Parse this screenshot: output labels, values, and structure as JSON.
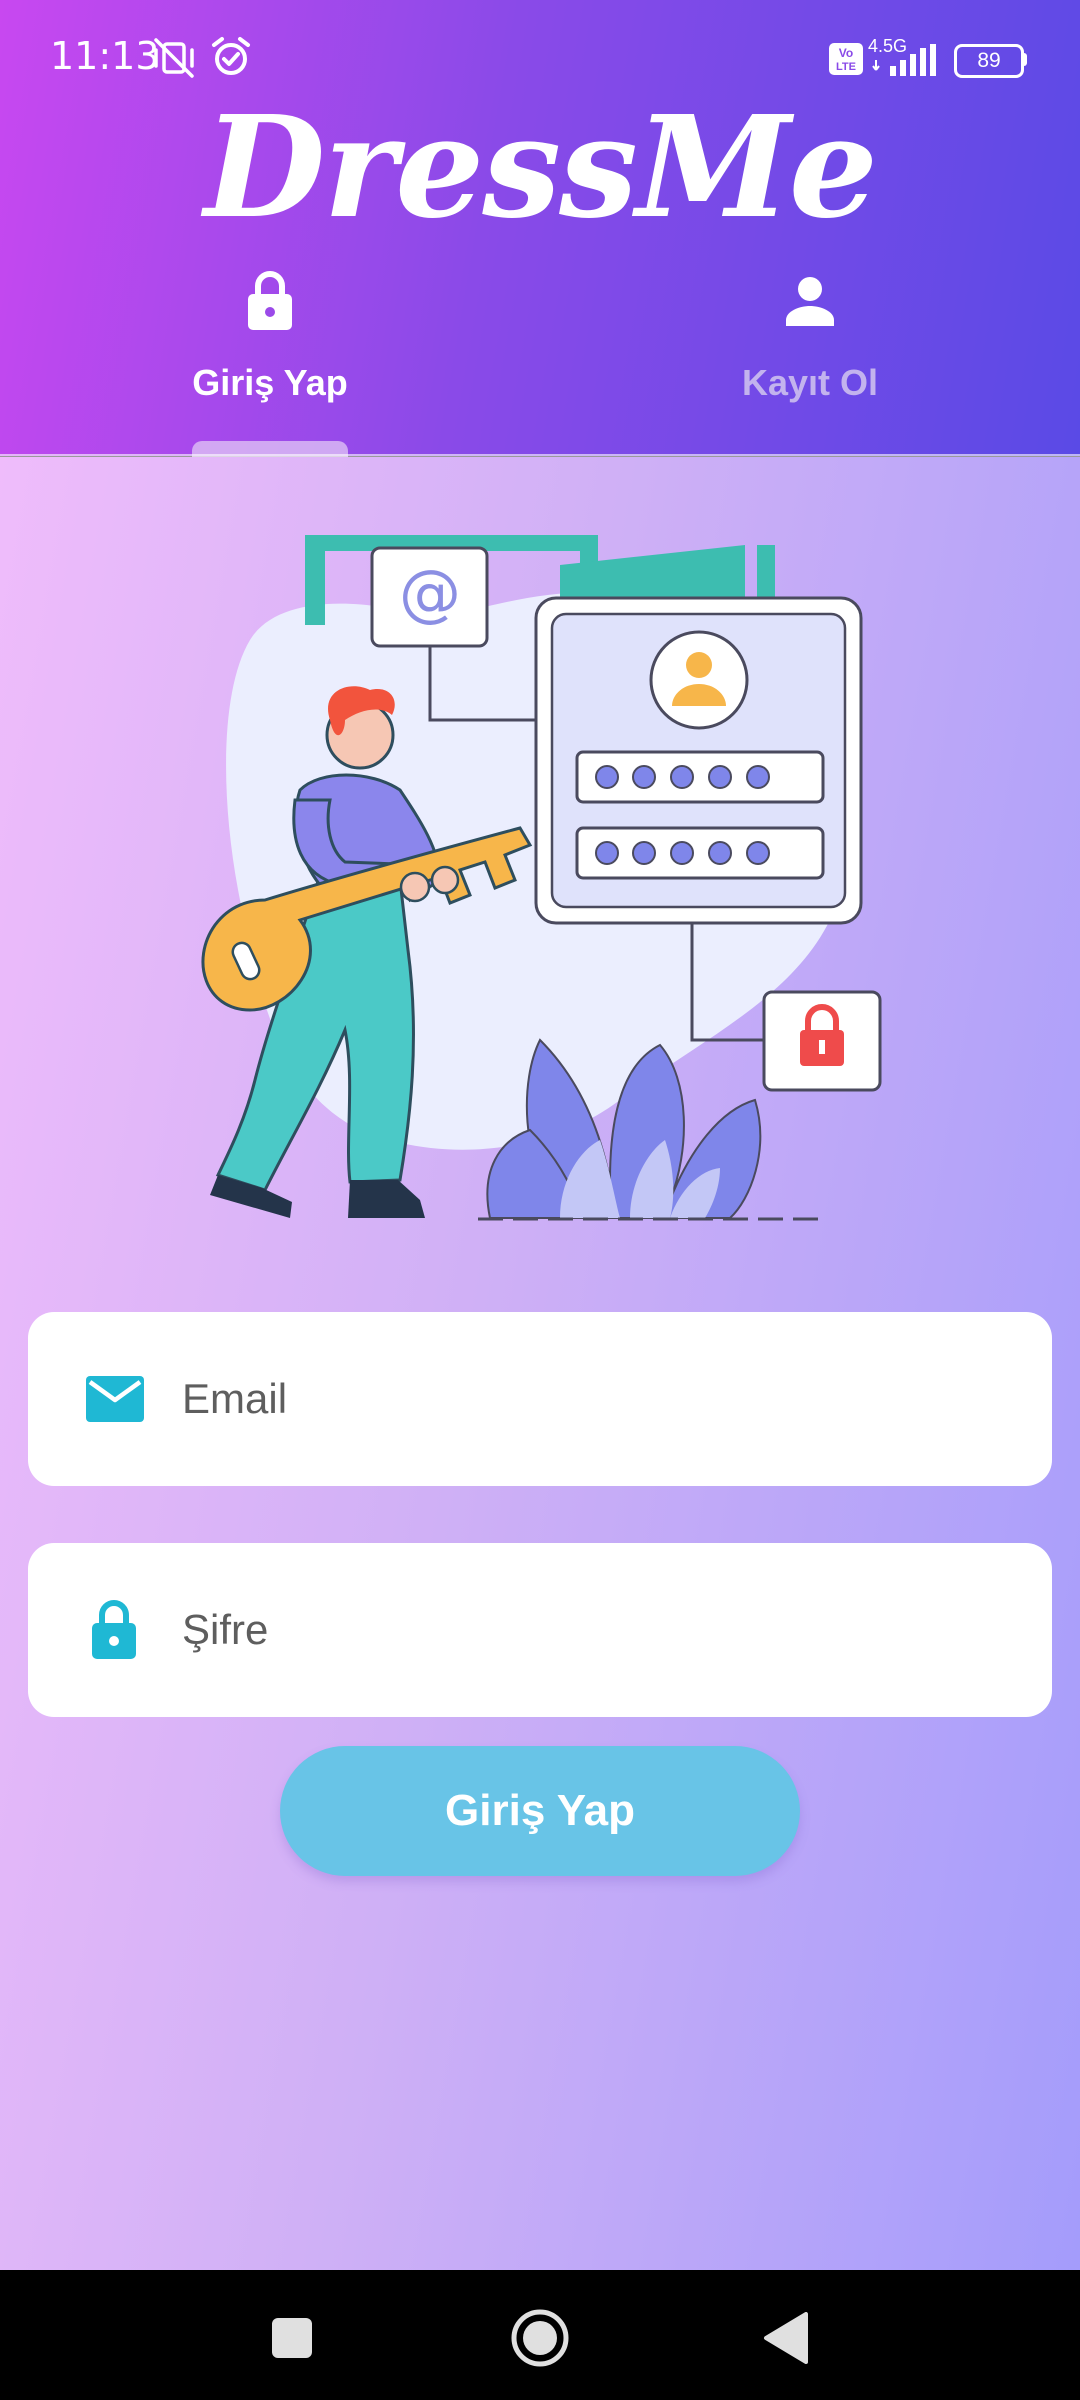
{
  "status_bar": {
    "time": "11:13",
    "network": "4.5G",
    "volte": "Vo LTE",
    "battery": "89"
  },
  "app": {
    "logo": "DressMe"
  },
  "tabs": [
    {
      "label": "Giriş Yap",
      "icon": "lock-icon",
      "active": true
    },
    {
      "label": "Kayıt Ol",
      "icon": "person-icon",
      "active": false
    }
  ],
  "form": {
    "email_placeholder": "Email",
    "password_placeholder": "Şifre",
    "submit_label": "Giriş Yap"
  },
  "colors": {
    "header_start": "#c848f0",
    "header_end": "#5a4ae6",
    "accent": "#1fb8d4",
    "button": "#68c4e7",
    "tab_inactive": "#c3b3ee"
  }
}
